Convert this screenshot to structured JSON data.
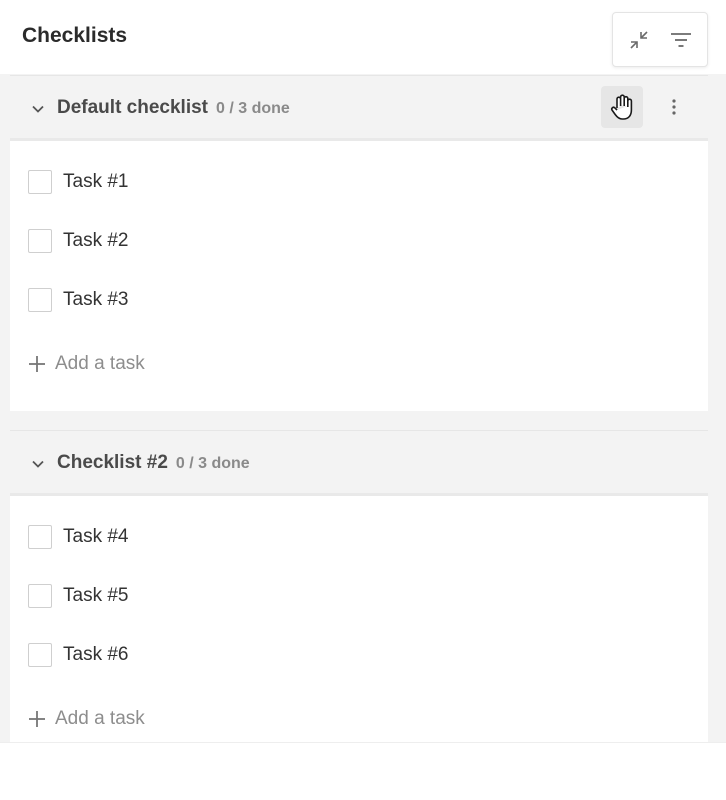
{
  "header": {
    "title": "Checklists",
    "tools": [
      {
        "name": "collapse-all",
        "icon": "collapse-icon"
      },
      {
        "name": "filter",
        "icon": "filter-icon"
      }
    ]
  },
  "checklists": [
    {
      "name": "Default checklist",
      "progress": "0 / 3 done",
      "tasks": [
        {
          "label": "Task #1",
          "done": false
        },
        {
          "label": "Task #2",
          "done": false
        },
        {
          "label": "Task #3",
          "done": false
        }
      ],
      "add_task_label": "Add a task"
    },
    {
      "name": "Checklist #2",
      "progress": "0 / 3 done",
      "tasks": [
        {
          "label": "Task #4",
          "done": false
        },
        {
          "label": "Task #5",
          "done": false
        },
        {
          "label": "Task #6",
          "done": false
        }
      ],
      "add_task_label": "Add a task"
    }
  ],
  "colors": {
    "accent_text": "#2b2b2b",
    "muted_text": "#8a8a8a",
    "panel_bg": "#f3f3f3"
  }
}
